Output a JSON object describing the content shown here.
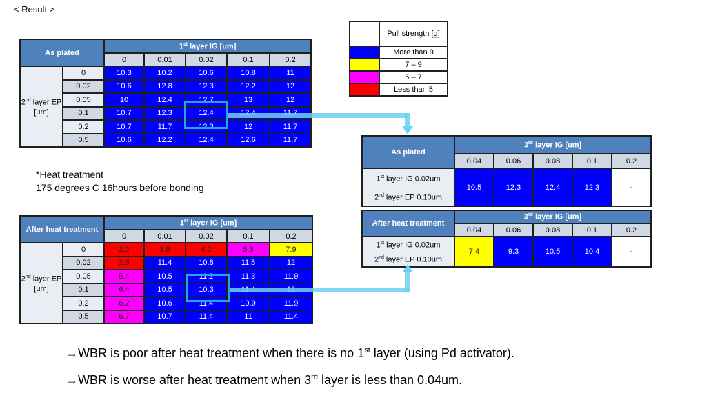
{
  "title": "< Result >",
  "legend": {
    "header": "Pull strength [g]",
    "items": [
      {
        "label": "More than 9",
        "color": "#0000ff"
      },
      {
        "label": "7 – 9",
        "color": "#ffff00"
      },
      {
        "label": "5 – 7",
        "color": "#ff00ff"
      },
      {
        "label": "Less than 5",
        "color": "#ff0000"
      }
    ]
  },
  "table_as_plated": {
    "corner": "As plated",
    "col_title_sup": "st",
    "col_title_pre": "1",
    "col_title": " layer IG [um]",
    "row_title_pre": "2",
    "row_title_sup": "nd",
    "row_title": " layer EP [um]",
    "cols": [
      "0",
      "0.01",
      "0.02",
      "0.1",
      "0.2"
    ],
    "rows": [
      "0",
      "0.02",
      "0.05",
      "0.1",
      "0.2",
      "0.5"
    ],
    "values": [
      [
        "10.3",
        "10.2",
        "10.6",
        "10.8",
        "11"
      ],
      [
        "10.6",
        "12.8",
        "12.3",
        "12.2",
        "12"
      ],
      [
        "10",
        "12.4",
        "12.7",
        "13",
        "12"
      ],
      [
        "10.7",
        "12.3",
        "12.4",
        "12.4",
        "11.7"
      ],
      [
        "10.7",
        "11.7",
        "12.3",
        "12",
        "11.7"
      ],
      [
        "10.6",
        "12.2",
        "12.4",
        "12.6",
        "11.7"
      ]
    ],
    "colors": [
      [
        "blue",
        "blue",
        "blue",
        "blue",
        "blue"
      ],
      [
        "blue",
        "blue",
        "blue",
        "blue",
        "blue"
      ],
      [
        "blue",
        "blue",
        "blue",
        "blue",
        "blue"
      ],
      [
        "blue",
        "blue",
        "blue",
        "blue",
        "blue"
      ],
      [
        "blue",
        "blue",
        "blue",
        "blue",
        "blue"
      ],
      [
        "blue",
        "blue",
        "blue",
        "blue",
        "blue"
      ]
    ]
  },
  "table_after_heat": {
    "corner": "After heat treatment",
    "col_title_sup": "st",
    "col_title_pre": "1",
    "col_title": " layer IG [um]",
    "row_title_pre": "2",
    "row_title_sup": "nd",
    "row_title": " layer EP [um]",
    "cols": [
      "0",
      "0.01",
      "0.02",
      "0.1",
      "0.2"
    ],
    "rows": [
      "0",
      "0.02",
      "0.05",
      "0.1",
      "0.2",
      "0.5"
    ],
    "values": [
      [
        "2.2",
        "3.9",
        "4.2",
        "5.6",
        "7.9"
      ],
      [
        "2.6",
        "11.4",
        "10.8",
        "11.5",
        "12"
      ],
      [
        "5.4",
        "10.5",
        "11.2",
        "11.3",
        "11.9"
      ],
      [
        "6.4",
        "10.5",
        "10.3",
        "11.4",
        "12"
      ],
      [
        "6.2",
        "10.6",
        "11.4",
        "10.9",
        "11.9"
      ],
      [
        "6.7",
        "10.7",
        "11.4",
        "11",
        "11.4"
      ]
    ],
    "colors": [
      [
        "red",
        "red",
        "red",
        "magenta",
        "yellow"
      ],
      [
        "red",
        "blue",
        "blue",
        "blue",
        "blue"
      ],
      [
        "magenta",
        "blue",
        "blue",
        "blue",
        "blue"
      ],
      [
        "magenta",
        "blue",
        "blue",
        "blue",
        "blue"
      ],
      [
        "magenta",
        "blue",
        "blue",
        "blue",
        "blue"
      ],
      [
        "magenta",
        "blue",
        "blue",
        "blue",
        "blue"
      ]
    ]
  },
  "table3_as_plated": {
    "corner": "As plated",
    "col_title_pre": "3",
    "col_title_sup": "rd",
    "col_title": " layer IG [um]",
    "cols": [
      "0.04",
      "0.06",
      "0.08",
      "0.1",
      "0.2"
    ],
    "row_line1_pre": "1",
    "row_line1_sup": "st",
    "row_line1": " layer IG 0.02um",
    "row_line2_pre": "2",
    "row_line2_sup": "nd",
    "row_line2": " layer EP 0.10um",
    "values": [
      "10.5",
      "12.3",
      "12.4",
      "12.3",
      "-"
    ],
    "colors": [
      "blue",
      "blue",
      "blue",
      "blue",
      "white"
    ]
  },
  "table4_after_heat": {
    "corner": "After heat treatment",
    "col_title_pre": "3",
    "col_title_sup": "rd",
    "col_title": " layer IG [um]",
    "cols": [
      "0.04",
      "0.06",
      "0.08",
      "0.1",
      "0.2"
    ],
    "row_line1_pre": "1",
    "row_line1_sup": "st",
    "row_line1": " layer IG 0.02um",
    "row_line2_pre": "2",
    "row_line2_sup": "nd",
    "row_line2": " layer EP 0.10um",
    "values": [
      "7.4",
      "9.3",
      "10.5",
      "10.4",
      "-"
    ],
    "colors": [
      "yellow",
      "blue",
      "blue",
      "blue",
      "white"
    ]
  },
  "heat_note": {
    "title": "Heat treatment",
    "prefix": "*",
    "detail": "175 degrees C  16hours before bonding"
  },
  "conclusions": [
    {
      "arrow": "→",
      "pre": "WBR is poor after heat treatment when there is no 1",
      "sup": "st",
      "post": " layer  (using Pd activator)."
    },
    {
      "arrow": "→",
      "pre": "WBR is worse after heat treatment when 3",
      "sup": "rd",
      "post": " layer is less than 0.04um."
    }
  ]
}
